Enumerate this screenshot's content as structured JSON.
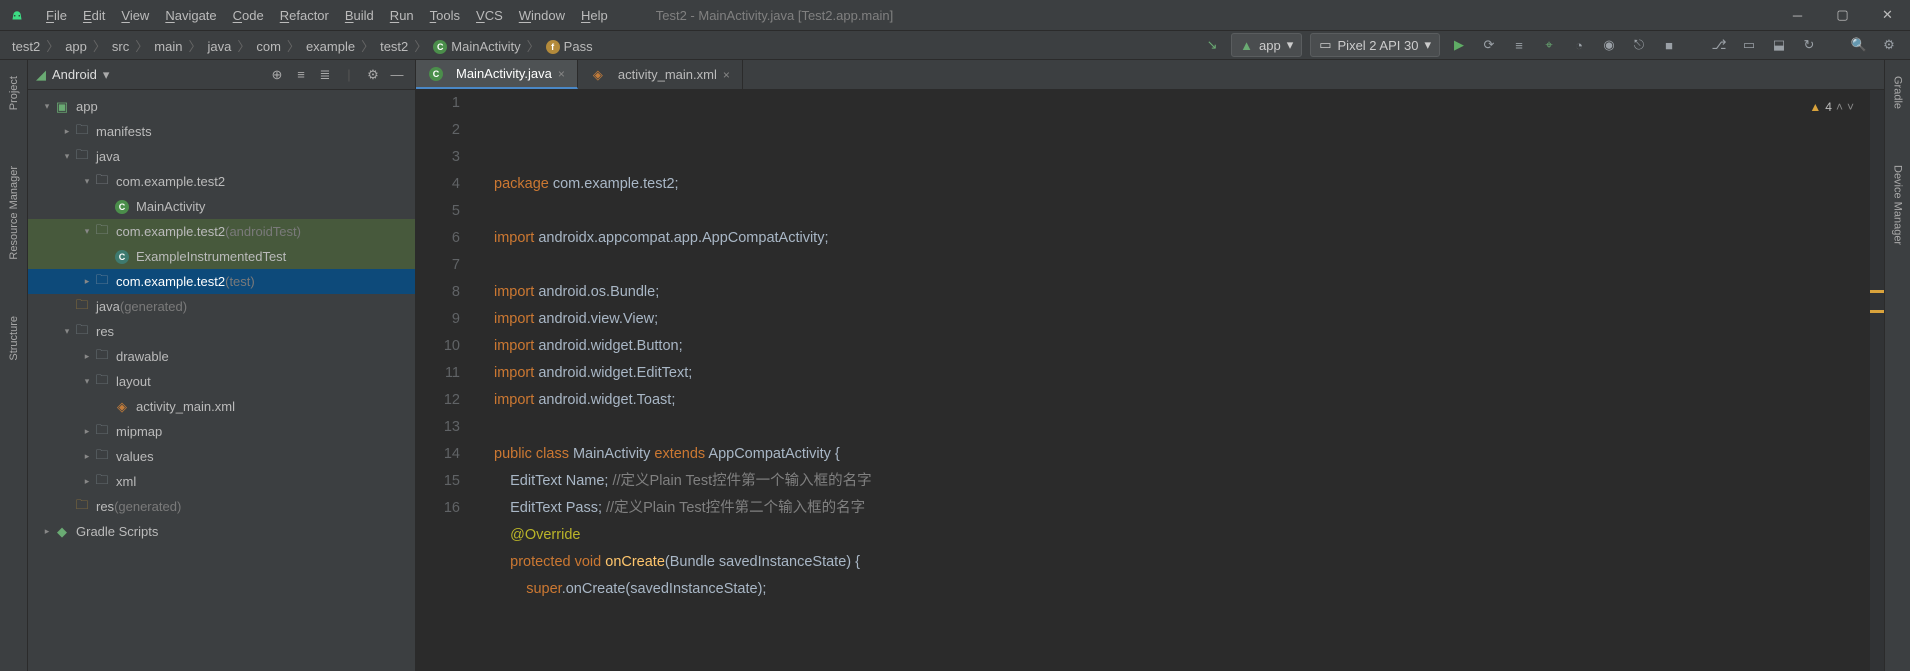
{
  "window_title": "Test2 - MainActivity.java [Test2.app.main]",
  "menu": [
    "File",
    "Edit",
    "View",
    "Navigate",
    "Code",
    "Refactor",
    "Build",
    "Run",
    "Tools",
    "VCS",
    "Window",
    "Help"
  ],
  "breadcrumbs": [
    "test2",
    "app",
    "src",
    "main",
    "java",
    "com",
    "example",
    "test2",
    "MainActivity",
    "Pass"
  ],
  "run_configs": {
    "module": "app",
    "device": "Pixel 2 API 30"
  },
  "project_panel": {
    "title": "Android"
  },
  "tree": [
    {
      "d": 0,
      "a": "v",
      "ic": "mod",
      "t": "app",
      "cls": ""
    },
    {
      "d": 1,
      "a": ">",
      "ic": "dir",
      "t": "manifests",
      "cls": ""
    },
    {
      "d": 1,
      "a": "v",
      "ic": "dir",
      "t": "java",
      "cls": ""
    },
    {
      "d": 2,
      "a": "v",
      "ic": "pkg",
      "t": "com.example.test2",
      "cls": ""
    },
    {
      "d": 3,
      "a": "",
      "ic": "cls",
      "t": "MainActivity",
      "cls": ""
    },
    {
      "d": 2,
      "a": "v",
      "ic": "pkg",
      "t": "com.example.test2",
      "suf": "(androidTest)",
      "cls": "highlight"
    },
    {
      "d": 3,
      "a": "",
      "ic": "cls-g",
      "t": "ExampleInstrumentedTest",
      "cls": "highlight"
    },
    {
      "d": 2,
      "a": ">",
      "ic": "pkg",
      "t": "com.example.test2",
      "suf": "(test)",
      "cls": "selected"
    },
    {
      "d": 1,
      "a": "",
      "ic": "gen",
      "t": "java",
      "suf": "(generated)",
      "cls": ""
    },
    {
      "d": 1,
      "a": "v",
      "ic": "dir",
      "t": "res",
      "cls": ""
    },
    {
      "d": 2,
      "a": ">",
      "ic": "dir",
      "t": "drawable",
      "cls": ""
    },
    {
      "d": 2,
      "a": "v",
      "ic": "dir",
      "t": "layout",
      "cls": ""
    },
    {
      "d": 3,
      "a": "",
      "ic": "xml",
      "t": "activity_main.xml",
      "cls": ""
    },
    {
      "d": 2,
      "a": ">",
      "ic": "dir",
      "t": "mipmap",
      "cls": ""
    },
    {
      "d": 2,
      "a": ">",
      "ic": "dir",
      "t": "values",
      "cls": ""
    },
    {
      "d": 2,
      "a": ">",
      "ic": "dir",
      "t": "xml",
      "cls": ""
    },
    {
      "d": 1,
      "a": "",
      "ic": "gen",
      "t": "res",
      "suf": "(generated)",
      "cls": ""
    },
    {
      "d": 0,
      "a": ">",
      "ic": "gradle",
      "t": "Gradle Scripts",
      "cls": ""
    }
  ],
  "tabs": [
    {
      "icon": "cls",
      "label": "MainActivity.java",
      "active": true
    },
    {
      "icon": "xml",
      "label": "activity_main.xml",
      "active": false
    }
  ],
  "problems": {
    "warnings": 4
  },
  "code_lines": [
    {
      "n": 1,
      "html": "<span class='kw'>package</span> com.example.test2;"
    },
    {
      "n": 2,
      "html": ""
    },
    {
      "n": 3,
      "html": "<span class='kw'>import</span> androidx.appcompat.app.AppCompatActivity;"
    },
    {
      "n": 4,
      "html": ""
    },
    {
      "n": 5,
      "html": "<span class='kw'>import</span> android.os.Bundle;"
    },
    {
      "n": 6,
      "html": "<span class='kw'>import</span> android.view.View;"
    },
    {
      "n": 7,
      "html": "<span class='kw'>import</span> android.widget.Button;"
    },
    {
      "n": 8,
      "html": "<span class='kw'>import</span> android.widget.EditText;"
    },
    {
      "n": 9,
      "html": "<span class='kw'>import</span> android.widget.Toast;"
    },
    {
      "n": 10,
      "html": ""
    },
    {
      "n": 11,
      "html": "<span class='kw'>public class</span> MainActivity <span class='kw'>extends</span> AppCompatActivity {"
    },
    {
      "n": 12,
      "html": "    EditText Name; <span class='comment'>//定义Plain Test控件第一个输入框的名字</span>"
    },
    {
      "n": 13,
      "html": "    EditText Pass; <span class='comment'>//定义Plain Test控件第二个输入框的名字</span>"
    },
    {
      "n": 14,
      "html": "    <span class='anno'>@Override</span>"
    },
    {
      "n": 15,
      "html": "    <span class='kw'>protected void</span> <span class='fn'>onCreate</span>(Bundle savedInstanceState) {"
    },
    {
      "n": 16,
      "html": "        <span class='kw'>super</span>.onCreate(savedInstanceState);"
    }
  ],
  "side_tabs_left": [
    "Project",
    "Resource Manager",
    "Structure"
  ],
  "side_tabs_right": [
    "Gradle",
    "Device Manager"
  ]
}
